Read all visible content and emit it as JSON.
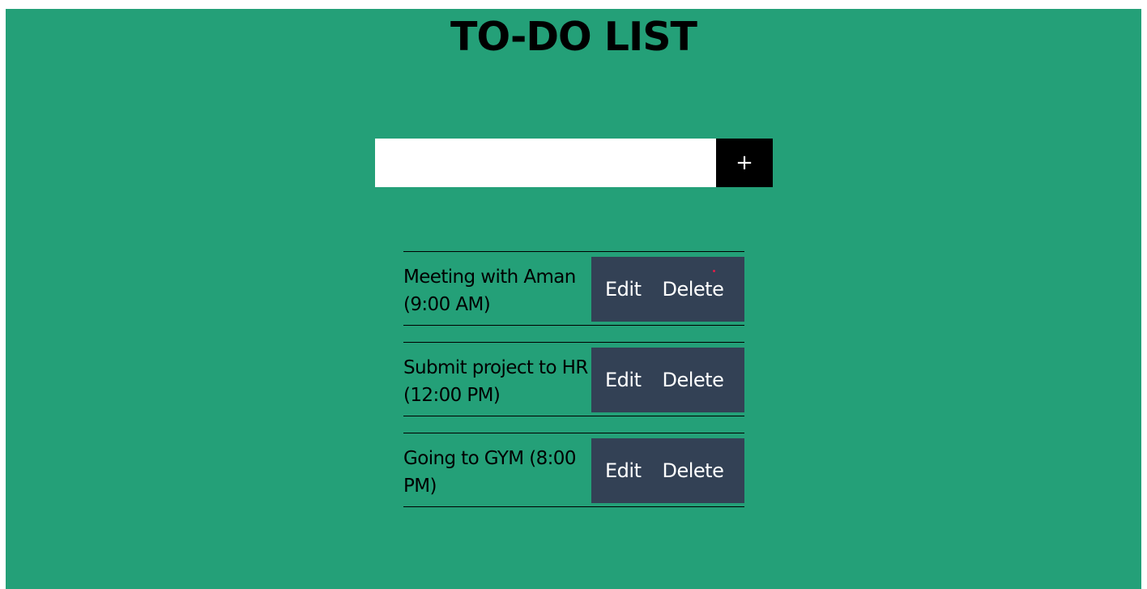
{
  "app": {
    "title": "TO-DO LIST"
  },
  "input": {
    "value": "",
    "placeholder": "",
    "add_label": "+"
  },
  "tasks": [
    {
      "text": "Meeting with Aman (9:00 AM)",
      "edit_label": "Edit",
      "delete_label": "Delete"
    },
    {
      "text": "Submit project to HR (12:00 PM)",
      "edit_label": "Edit",
      "delete_label": "Delete"
    },
    {
      "text": "Going to GYM (8:00 PM)",
      "edit_label": "Edit",
      "delete_label": "Delete"
    }
  ],
  "colors": {
    "background": "#24a078",
    "action_panel": "#334155",
    "add_button": "#000000",
    "title": "#000000"
  }
}
